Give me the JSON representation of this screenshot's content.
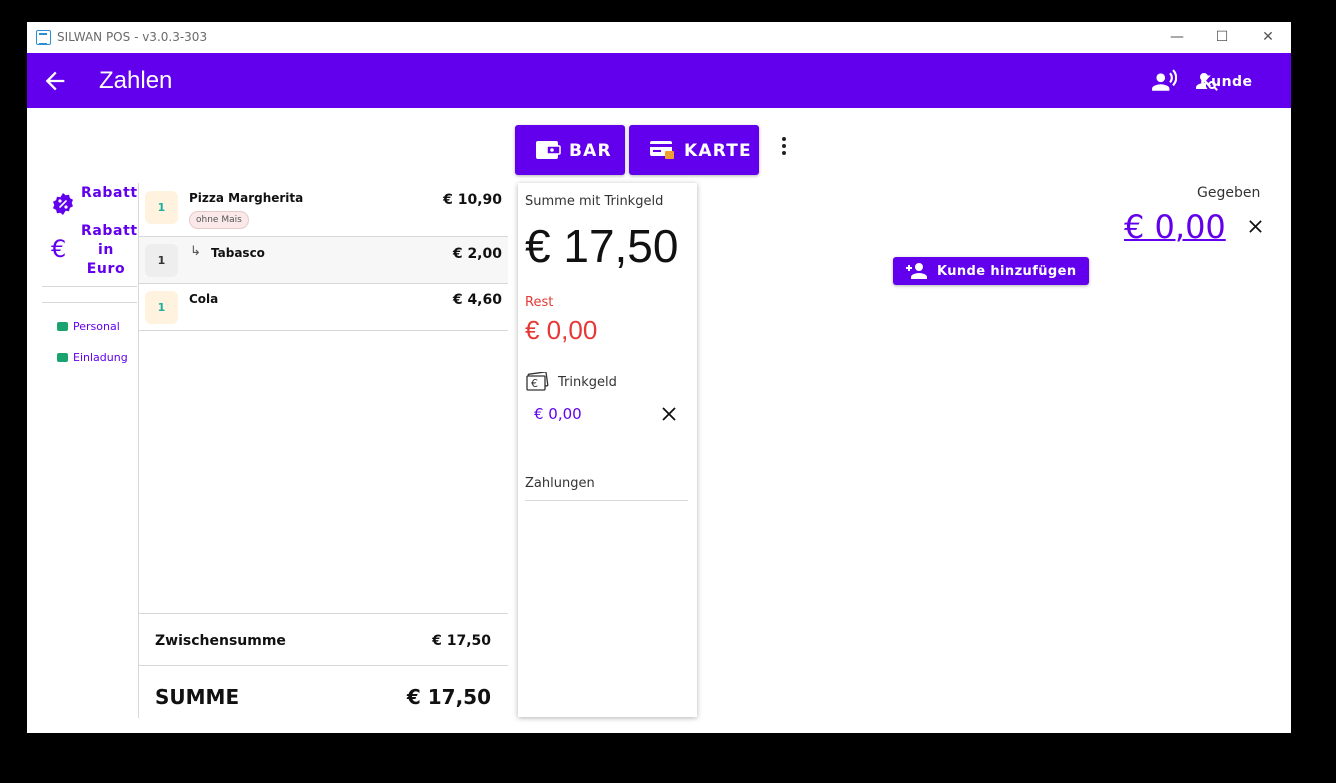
{
  "window": {
    "title": "SILWAN POS - v3.0.3-303"
  },
  "appbar": {
    "title": "Zahlen",
    "customer_label": "Kunde"
  },
  "payment_methods": {
    "cash_label": "BAR",
    "card_label": "KARTE"
  },
  "discounts": {
    "percent_label": "Rabatt",
    "euro_label": "Rabatt in Euro"
  },
  "vouchers": [
    "Personal",
    "Einladung"
  ],
  "order": {
    "items": [
      {
        "qty": "1",
        "name": "Pizza Margherita",
        "price": "€ 10,90",
        "modifier": "ohne Mais"
      },
      {
        "qty": "1",
        "name": "Tabasco",
        "price": "€ 2,00",
        "addon_arrow": "↳"
      },
      {
        "qty": "1",
        "name": "Cola",
        "price": "€ 4,60"
      }
    ],
    "subtotal_label": "Zwischensumme",
    "subtotal_value": "€ 17,50",
    "total_label": "SUMME",
    "total_value": "€ 17,50"
  },
  "summary": {
    "sum_label": "Summe mit Trinkgeld",
    "sum_value": "€ 17,50",
    "rest_label": "Rest",
    "rest_value": "€ 0,00",
    "tip_label": "Trinkgeld",
    "tip_value": "€ 0,00",
    "payments_label": "Zahlungen"
  },
  "given": {
    "label": "Gegeben",
    "value": "€ 0,00"
  },
  "add_customer_label": "Kunde hinzufügen",
  "colors": {
    "primary": "#6200ee",
    "rest_red": "#e53935",
    "voucher_green": "#1aa36f",
    "qty_orange_bg": "#fff3e0",
    "qty_grey_bg": "#eeeeee",
    "qty_teal": "#1ab0a0"
  }
}
